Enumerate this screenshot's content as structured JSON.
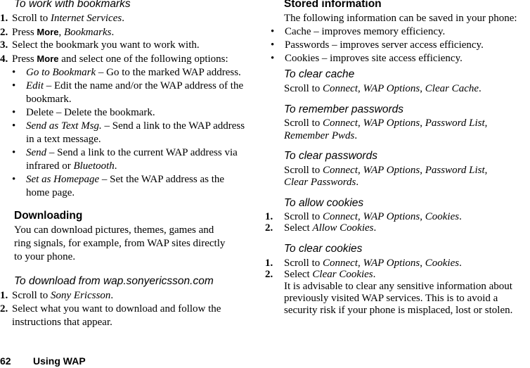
{
  "left": {
    "bookmarks_heading": "To work with bookmarks",
    "bookmarks_steps": {
      "s1_num": "1.",
      "s1_pre": "Scroll to ",
      "s1_it": "Internet Services",
      "s1_post": ".",
      "s2_num": "2.",
      "s2_pre": "Press ",
      "s2_key": "More",
      "s2_mid": ", ",
      "s2_it": "Bookmarks",
      "s2_post": ".",
      "s3_num": "3.",
      "s3_text": "Select the bookmark you want to work with.",
      "s4_num": "4.",
      "s4_pre": "Press ",
      "s4_key": "More",
      "s4_post": " and select one of the following options:"
    },
    "options": {
      "o1_it": "Go to Bookmark",
      "o1_text": " – Go to the marked WAP address.",
      "o2_it": "Edit",
      "o2_text": " – Edit the name and/or the WAP address of the",
      "o2_cont": "bookmark.",
      "o3_text": "Delete – Delete the bookmark.",
      "o4_it": "Send as Text Msg.",
      "o4_text": " – Send a link to the WAP address",
      "o4_cont": "in a text message.",
      "o5_it": "Send",
      "o5_text": " – Send a link to the current WAP address via",
      "o5_cont_pre": "infrared or ",
      "o5_cont_it": "Bluetooth",
      "o5_cont_post": ".",
      "o6_it": "Set as Homepage",
      "o6_text": " – Set the WAP address as the",
      "o6_cont": "home page."
    },
    "downloading_heading": "Downloading",
    "downloading_lines": [
      "You can download pictures, themes, games and",
      "ring signals, for example, from WAP sites directly",
      "to your phone."
    ],
    "download_heading": "To download from wap.sonyericsson.com",
    "download_steps": {
      "s1_num": "1.",
      "s1_pre": "Scroll to ",
      "s1_it": "Sony Ericsson",
      "s1_post": ".",
      "s2_num": "2.",
      "s2_text": "Select what you want to download and follow the",
      "s2_cont": "instructions that appear."
    }
  },
  "right": {
    "stored_heading": "Stored information",
    "stored_intro": "The following information can be saved in your phone:",
    "stored_items": [
      "Cache – improves memory efficiency.",
      "Passwords – improves server access efficiency.",
      "Cookies – improves site access efficiency."
    ],
    "clear_cache_heading": "To clear cache",
    "clear_cache": {
      "pre": "Scroll to ",
      "a": "Connect",
      "sep1": ", ",
      "b": "WAP Options",
      "sep2": ", ",
      "c": "Clear Cache",
      "post": "."
    },
    "remember_heading": "To remember passwords",
    "remember": {
      "pre": "Scroll to ",
      "a": "Connect",
      "sep1": ", ",
      "b": "WAP Options",
      "sep2": ", ",
      "c": "Password List",
      "sep3": ",",
      "d": "Remember Pwds",
      "post": "."
    },
    "clear_pw_heading": "To clear passwords",
    "clear_pw": {
      "pre": "Scroll to ",
      "a": "Connect",
      "sep1": ", ",
      "b": "WAP Options",
      "sep2": ", ",
      "c": "Password List",
      "sep3": ",",
      "d": "Clear Passwords",
      "post": "."
    },
    "allow_heading": "To allow cookies",
    "allow": {
      "s1_num": "1.",
      "s1_pre": "Scroll to ",
      "s1_a": "Connect",
      "s1_sep1": ", ",
      "s1_b": "WAP Options",
      "s1_sep2": ", ",
      "s1_c": "Cookies",
      "s1_post": ".",
      "s2_num": "2.",
      "s2_pre": "Select ",
      "s2_it": "Allow Cookies",
      "s2_post": "."
    },
    "clear_cookies_heading": "To clear cookies",
    "clear_cookies": {
      "s1_num": "1.",
      "s1_pre": "Scroll to ",
      "s1_a": "Connect",
      "s1_sep1": ", ",
      "s1_b": "WAP Options",
      "s1_sep2": ", ",
      "s1_c": "Cookies",
      "s1_post": ".",
      "s2_num": "2.",
      "s2_pre": "Select ",
      "s2_it": "Clear Cookies",
      "s2_post": "."
    },
    "advice_lines": [
      "It is advisable to clear any sensitive information about",
      "previously visited WAP services. This is to avoid a",
      "security risk if your phone is misplaced, lost or stolen."
    ]
  },
  "footer": {
    "page_number": "62",
    "section_title": "Using WAP"
  },
  "bullet_char": "•"
}
